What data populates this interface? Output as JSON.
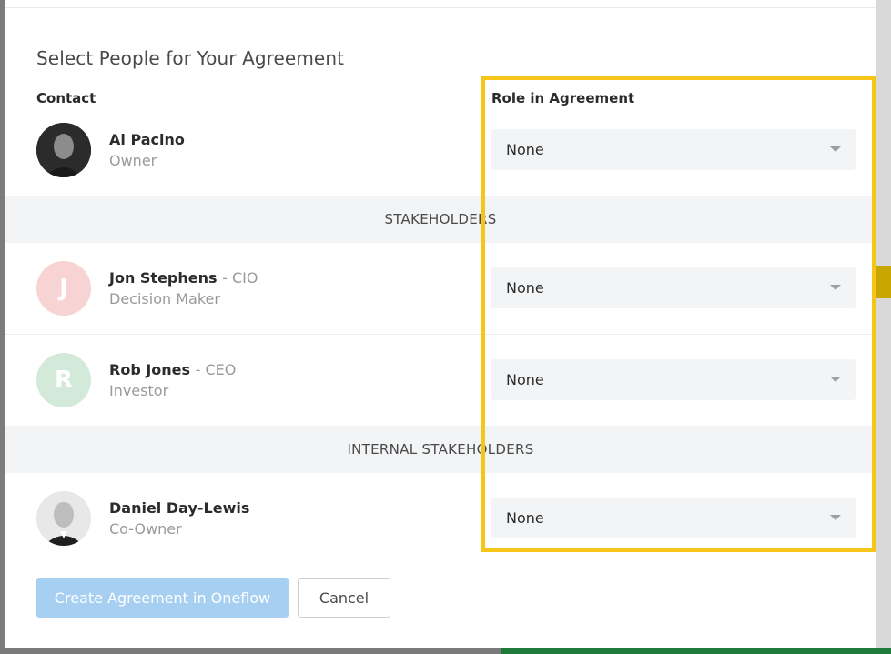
{
  "dialog": {
    "title": "Select People for Your Agreement",
    "columns": {
      "contact": "Contact",
      "role": "Role in Agreement"
    }
  },
  "sections": {
    "stakeholders": "STAKEHOLDERS",
    "internal": "INTERNAL STAKEHOLDERS"
  },
  "people": [
    {
      "name": "Al Pacino",
      "title": "",
      "subrole": "Owner",
      "avatar": "photo",
      "initial": "",
      "role_value": "None"
    },
    {
      "name": "Jon Stephens",
      "title": "- CIO",
      "subrole": "Decision Maker",
      "avatar": "initial",
      "initial": "J",
      "role_value": "None"
    },
    {
      "name": "Rob Jones",
      "title": "- CEO",
      "subrole": "Investor",
      "avatar": "initial",
      "initial": "R",
      "role_value": "None"
    },
    {
      "name": "Daniel Day-Lewis",
      "title": "",
      "subrole": "Co-Owner",
      "avatar": "photo",
      "initial": "",
      "role_value": "None"
    }
  ],
  "buttons": {
    "create": "Create Agreement in Oneflow",
    "cancel": "Cancel"
  },
  "colors": {
    "primary_button": "#a6cff2",
    "highlight": "#f5c518",
    "section_band": "#f3f4f6",
    "avatar_pink": "#f7d3d3",
    "avatar_green": "#d3eadb"
  },
  "icons": {
    "select_caret": "chevron-down-icon"
  }
}
